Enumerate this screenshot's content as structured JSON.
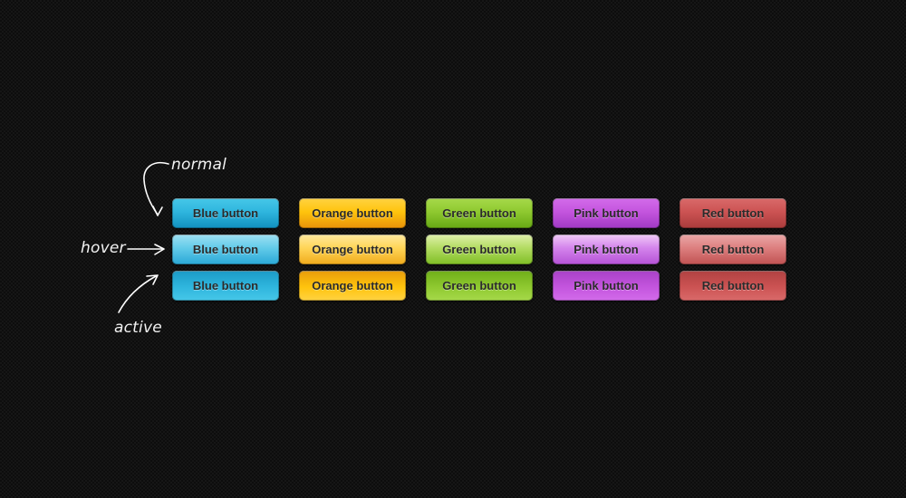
{
  "page": {
    "background_color": "#161616",
    "pattern_color": "#0d0d0d"
  },
  "annotations": [
    {
      "id": "normal",
      "label": "normal",
      "arrow": "curve-down-right"
    },
    {
      "id": "hover",
      "label": "hover",
      "arrow": "straight-right"
    },
    {
      "id": "active",
      "label": "active",
      "arrow": "curve-up-right"
    }
  ],
  "states": [
    "normal",
    "hover",
    "active"
  ],
  "buttons": {
    "columns": [
      {
        "key": "blue",
        "label": "Blue button",
        "accent": "#2fb6de"
      },
      {
        "key": "orange",
        "label": "Orange button",
        "accent": "#ffc40d"
      },
      {
        "key": "green",
        "label": "Green button",
        "accent": "#8fc930"
      },
      {
        "key": "pink",
        "label": "Pink button",
        "accent": "#c455de"
      },
      {
        "key": "red",
        "label": "Red button",
        "accent": "#cc5353"
      }
    ],
    "rows": [
      {
        "state": "normal",
        "cells": [
          {
            "label": "Blue button"
          },
          {
            "label": "Orange button"
          },
          {
            "label": "Green button"
          },
          {
            "label": "Pink button"
          },
          {
            "label": "Red button"
          }
        ]
      },
      {
        "state": "hover",
        "cells": [
          {
            "label": "Blue button"
          },
          {
            "label": "Orange button"
          },
          {
            "label": "Green button"
          },
          {
            "label": "Pink button"
          },
          {
            "label": "Red button"
          }
        ]
      },
      {
        "state": "active",
        "cells": [
          {
            "label": "Blue button"
          },
          {
            "label": "Orange button"
          },
          {
            "label": "Green button"
          },
          {
            "label": "Pink button"
          },
          {
            "label": "Red button"
          }
        ]
      }
    ]
  }
}
